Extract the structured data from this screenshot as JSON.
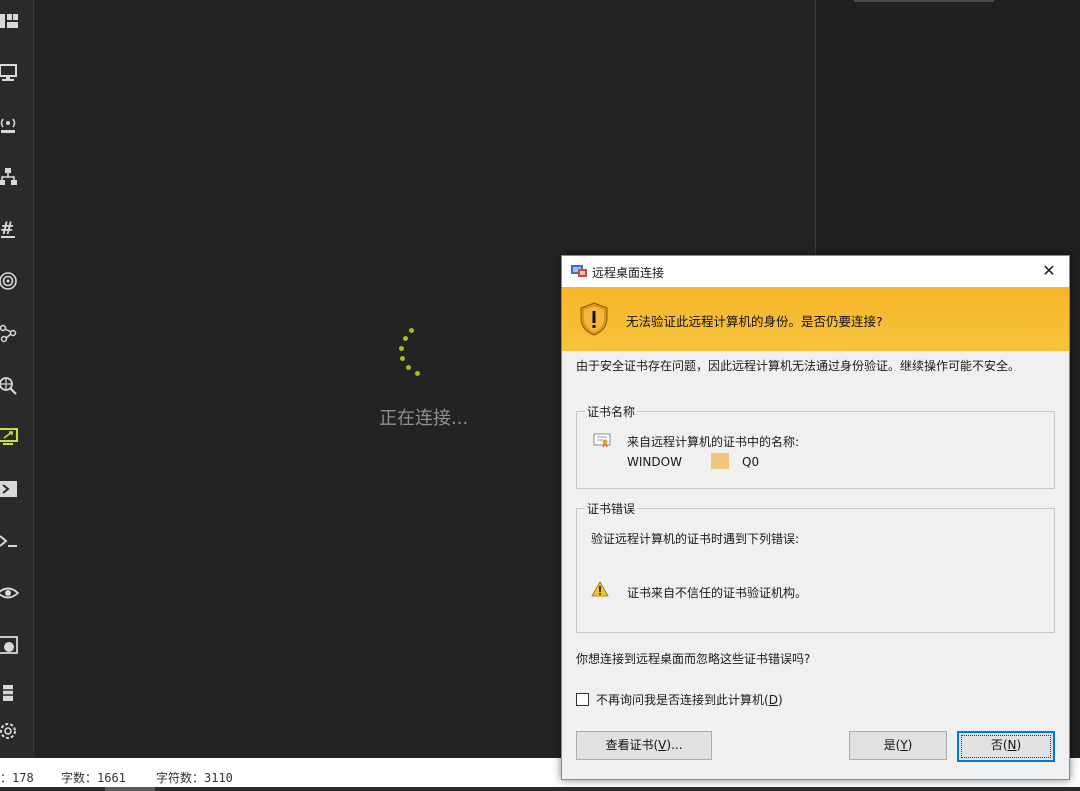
{
  "main": {
    "status_text": "正在连接..."
  },
  "statusbar": {
    "items": [
      "：178",
      "字数：1661",
      "字符数：3110"
    ]
  },
  "sidebar": {
    "icons": [
      "dashboard-icon",
      "monitor-icon",
      "wireless-icon",
      "network-icon",
      "hash-icon",
      "fingerprint-icon",
      "share-icon",
      "search-globe-icon",
      "remote-desktop-icon",
      "terminal-box-icon",
      "console-icon",
      "eye-icon",
      "web-icon",
      "server-icon",
      "settings-icon"
    ],
    "active_index": 8,
    "accent_color": "#c7e23a"
  },
  "dialog": {
    "title": "远程桌面连接",
    "close_label": "✕",
    "banner_text": "无法验证此远程计算机的身份。是否仍要连接?",
    "banner_color": "#f7b52a",
    "description": "由于安全证书存在问题，因此远程计算机无法通过身份验证。继续操作可能不安全。",
    "cert_name_group": {
      "legend": "证书名称",
      "line1": "来自远程计算机的证书中的名称:",
      "name_prefix": "WINDOW",
      "name_suffix": "Q0"
    },
    "cert_error_group": {
      "legend": "证书错误",
      "line1": "验证远程计算机的证书时遇到下列错误:",
      "error": "证书来自不信任的证书验证机构。"
    },
    "question": "你想连接到远程桌面而忽略这些证书错误吗?",
    "checkbox_label_pre": "不再询问我是否连接到此计算机(",
    "checkbox_key": "D",
    "checkbox_label_post": ")",
    "checkbox_checked": false,
    "buttons": {
      "view_cert_pre": "查看证书(",
      "view_cert_key": "V",
      "view_cert_post": ")...",
      "yes_pre": "是(",
      "yes_key": "Y",
      "yes_post": ")",
      "no_pre": "否(",
      "no_key": "N",
      "no_post": ")"
    }
  }
}
